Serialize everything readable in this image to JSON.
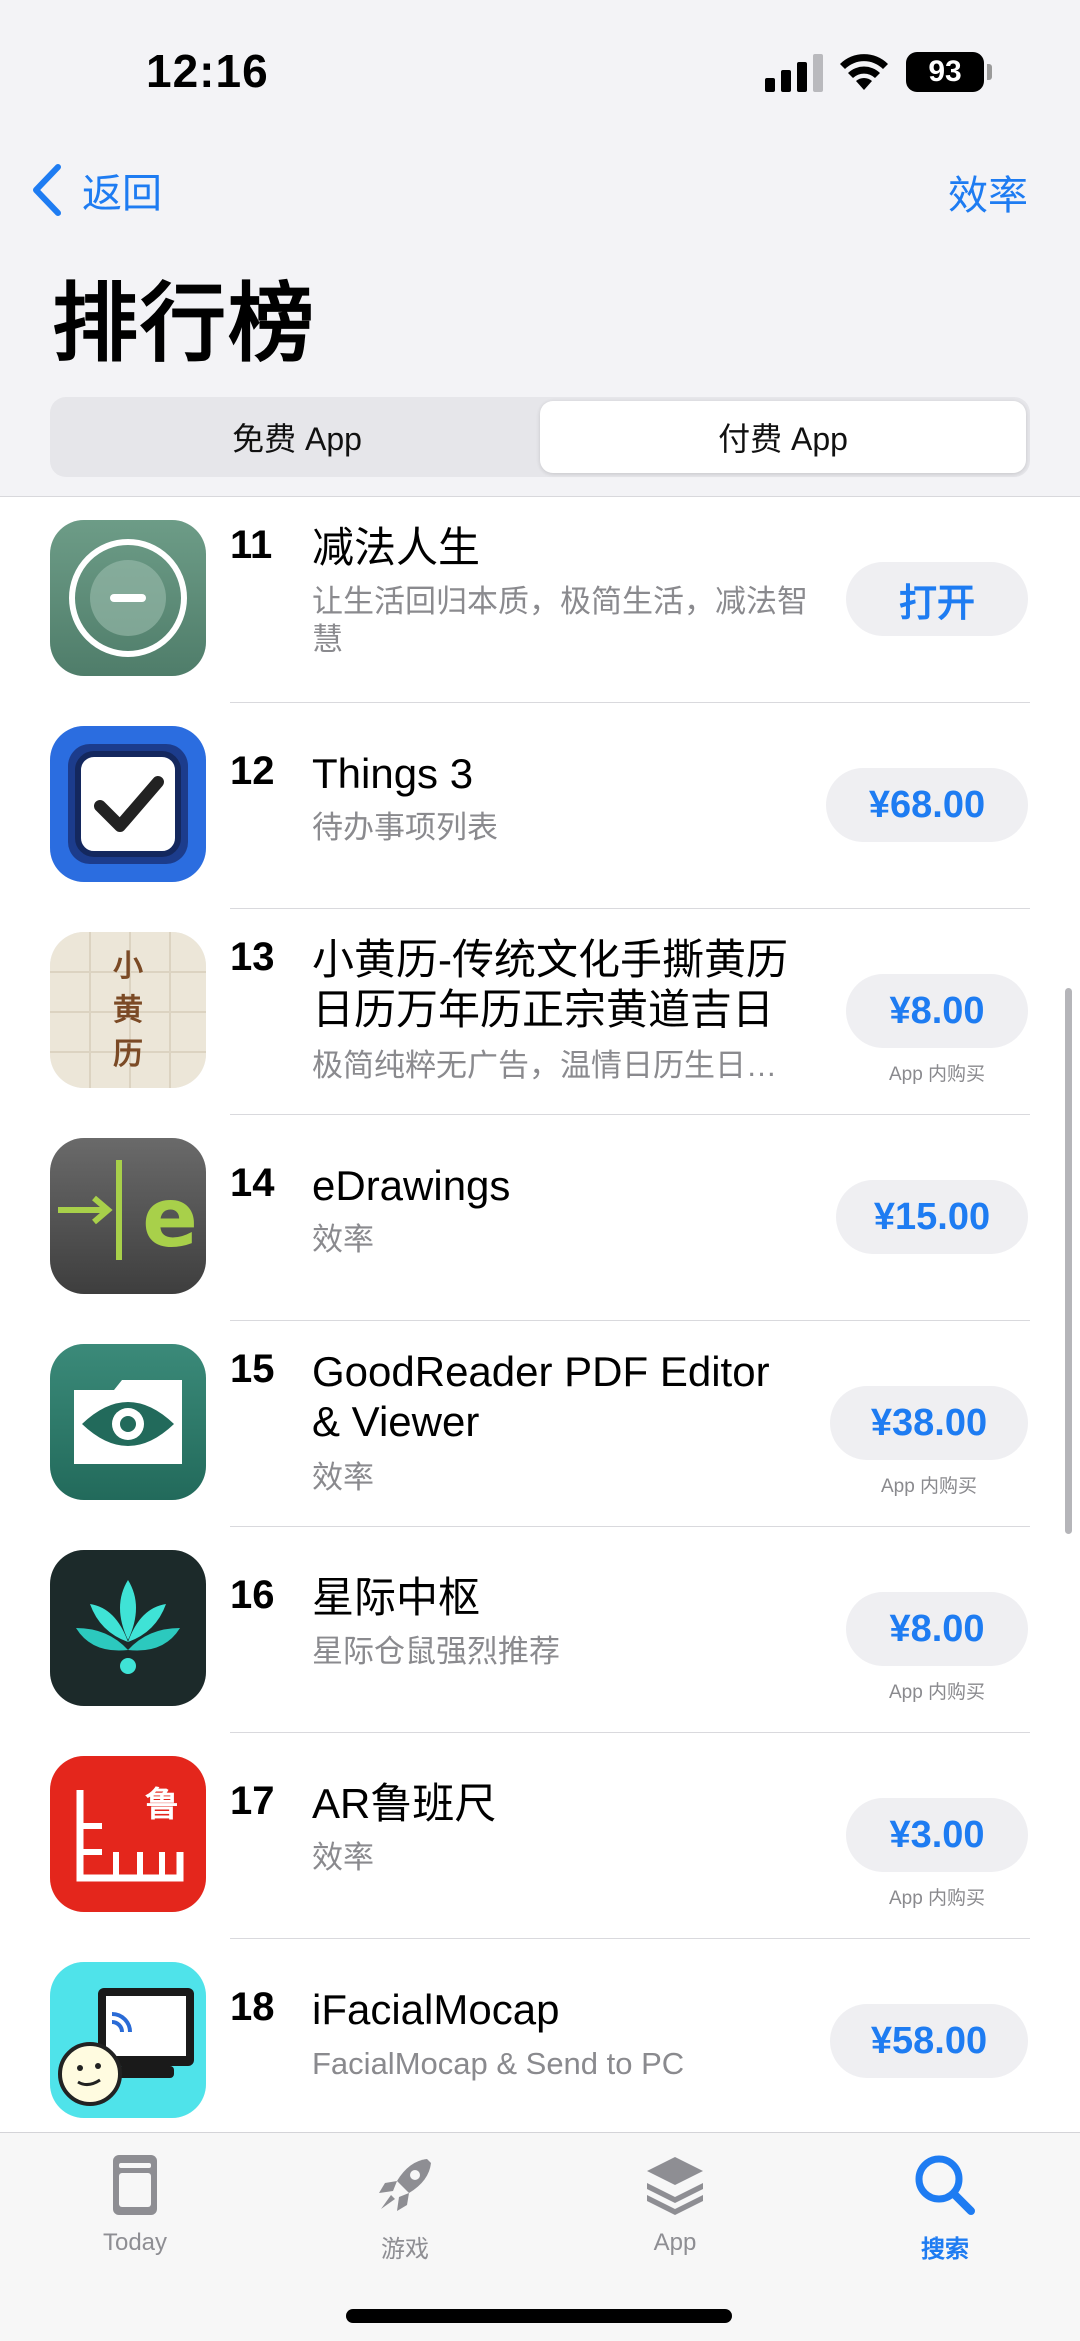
{
  "status_bar": {
    "time": "12:16",
    "battery": "93"
  },
  "nav": {
    "back_label": "返回",
    "category": "效率"
  },
  "page_title": "排行榜",
  "segments": {
    "free": "免费 App",
    "paid": "付费 App",
    "selected": "paid"
  },
  "apps": [
    {
      "rank": "11",
      "name": "减法人生",
      "subtitle": "让生活回归本质，极简生活，减法智慧",
      "action": "打开",
      "in_app_purchase": "",
      "icon": "minus-circle-icon"
    },
    {
      "rank": "12",
      "name": "Things 3",
      "subtitle": "待办事项列表",
      "action": "¥68.00",
      "in_app_purchase": "",
      "icon": "checkbox-icon"
    },
    {
      "rank": "13",
      "name": "小黄历-传统文化手撕黄历日历万年历正宗黄道吉日",
      "subtitle": "极简纯粹无广告，温情日历生日…",
      "action": "¥8.00",
      "in_app_purchase": "App 内购买",
      "icon": "almanac-icon",
      "icon_text": "小黄历"
    },
    {
      "rank": "14",
      "name": "eDrawings",
      "subtitle": "效率",
      "action": "¥15.00",
      "in_app_purchase": "",
      "icon": "edrawings-icon",
      "icon_text": "e"
    },
    {
      "rank": "15",
      "name": "GoodReader PDF Editor & Viewer",
      "subtitle": "效率",
      "action": "¥38.00",
      "in_app_purchase": "App 内购买",
      "icon": "eye-folder-icon"
    },
    {
      "rank": "16",
      "name": "星际中枢",
      "subtitle": "星际仓鼠强烈推荐",
      "action": "¥8.00",
      "in_app_purchase": "App 内购买",
      "icon": "lotus-icon"
    },
    {
      "rank": "17",
      "name": "AR鲁班尺",
      "subtitle": "效率",
      "action": "¥3.00",
      "in_app_purchase": "App 内购买",
      "icon": "ruler-icon",
      "icon_text": "鲁"
    },
    {
      "rank": "18",
      "name": "iFacialMocap",
      "subtitle": "FacialMocap & Send to PC",
      "action": "¥58.00",
      "in_app_purchase": "",
      "icon": "face-monitor-icon"
    }
  ],
  "tabs": [
    {
      "label": "Today",
      "icon": "today-icon"
    },
    {
      "label": "游戏",
      "icon": "rocket-icon"
    },
    {
      "label": "App",
      "icon": "layers-icon"
    },
    {
      "label": "搜索",
      "icon": "search-icon",
      "active": true
    }
  ],
  "colors": {
    "accent": "#1e7cf2",
    "secondary_text": "#8a8a8e"
  }
}
